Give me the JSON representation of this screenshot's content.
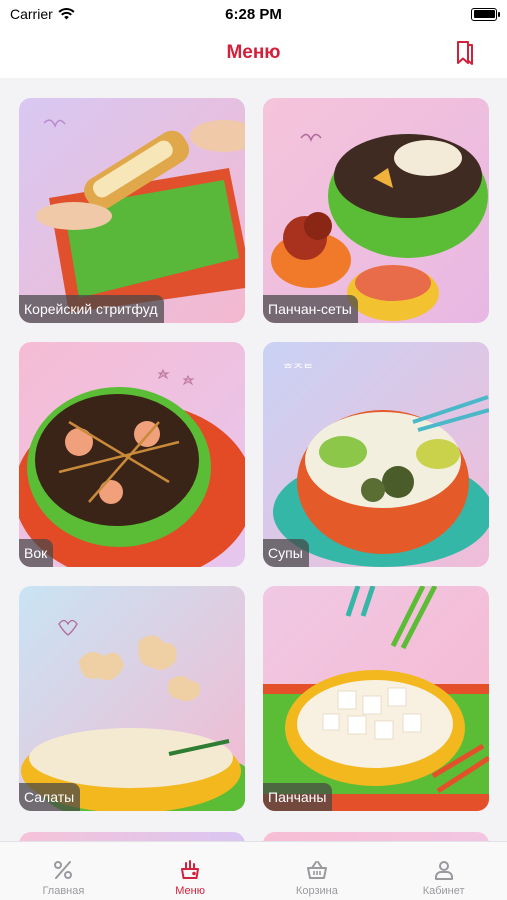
{
  "status_bar": {
    "carrier": "Carrier",
    "time": "6:28 PM",
    "battery_level": 1.0
  },
  "nav": {
    "title": "Меню",
    "bookmark_icon": "bookmark-icon"
  },
  "colors": {
    "accent": "#d3213b",
    "inactive": "#9a9a9e"
  },
  "categories": [
    {
      "label": "Корейский стритфуд"
    },
    {
      "label": "Панчан-сеты"
    },
    {
      "label": "Вок"
    },
    {
      "label": "Супы"
    },
    {
      "label": "Салаты"
    },
    {
      "label": "Панчаны"
    }
  ],
  "tabs": [
    {
      "label": "Главная",
      "icon": "percent-icon",
      "active": false
    },
    {
      "label": "Меню",
      "icon": "menu-bag-icon",
      "active": true
    },
    {
      "label": "Корзина",
      "icon": "basket-icon",
      "active": false
    },
    {
      "label": "Кабинет",
      "icon": "profile-icon",
      "active": false
    }
  ]
}
